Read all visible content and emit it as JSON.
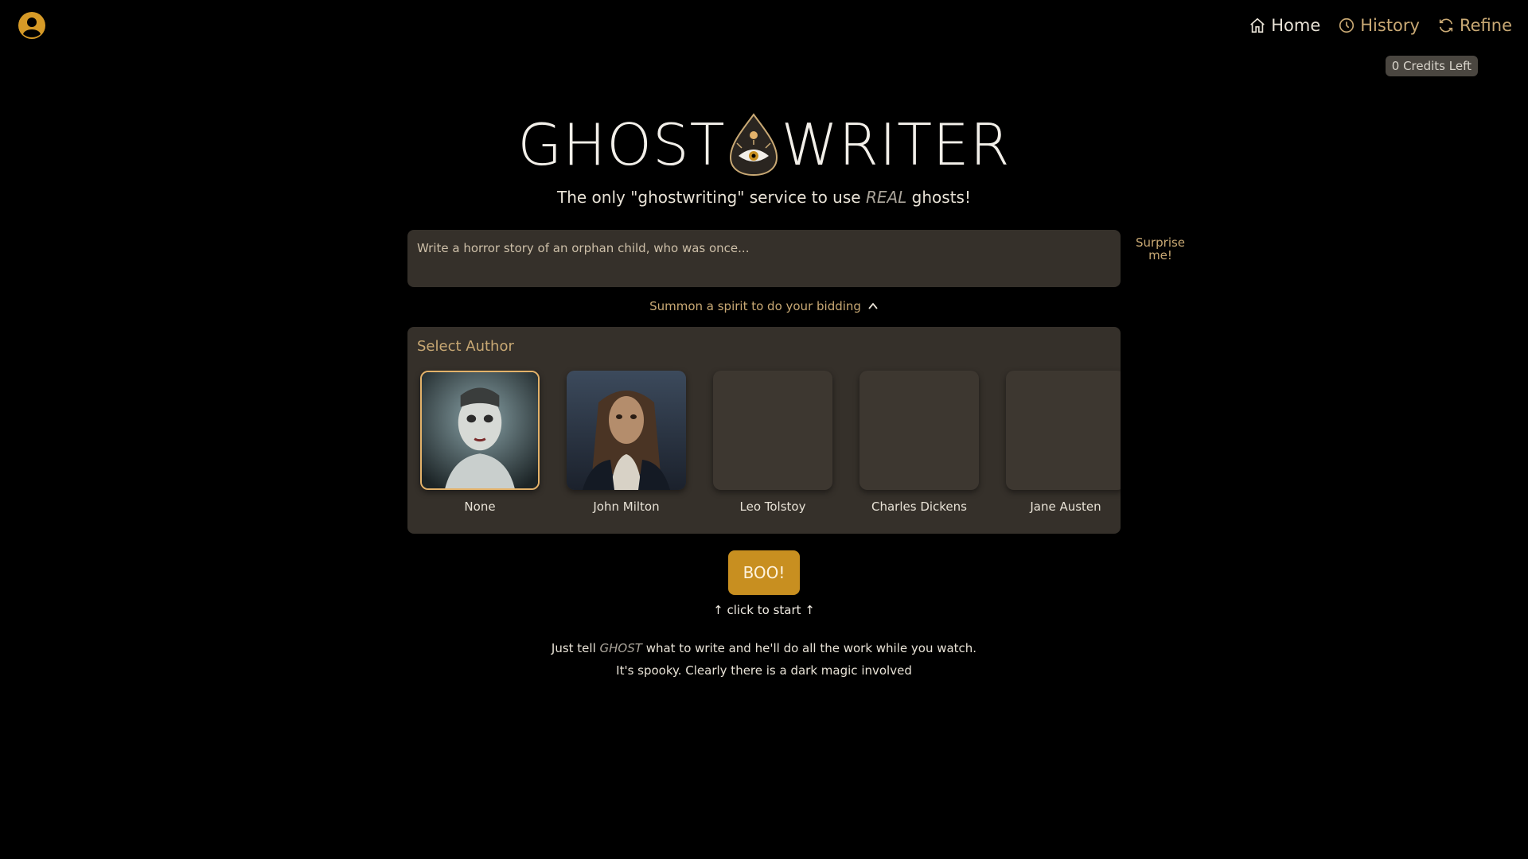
{
  "nav": {
    "items": [
      {
        "label": "Home",
        "icon": "home-icon"
      },
      {
        "label": "History",
        "icon": "clock-icon"
      },
      {
        "label": "Refine",
        "icon": "refresh-icon"
      }
    ],
    "credits": "0 Credits Left"
  },
  "hero": {
    "logo_left": "GHOST",
    "logo_right": "WRITER",
    "tagline_before": "The only \"ghostwriting\" service to use ",
    "tagline_emphasis": "REAL",
    "tagline_after": " ghosts!"
  },
  "prompt": {
    "placeholder": "Write a horror story of an orphan child, who was once...",
    "value": ""
  },
  "surprise_label": "Surprise me!",
  "summon_label": "Summon a spirit to do your bidding",
  "author_panel": {
    "title": "Select Author",
    "authors": [
      {
        "name": "None",
        "selected": true
      },
      {
        "name": "John Milton",
        "selected": false
      },
      {
        "name": "Leo Tolstoy",
        "selected": false
      },
      {
        "name": "Charles Dickens",
        "selected": false
      },
      {
        "name": "Jane Austen",
        "selected": false
      }
    ]
  },
  "boo_label": "BOO!",
  "hint": "↑ click to start ↑",
  "description": {
    "line1_before": "Just tell ",
    "line1_emphasis": "GHOST",
    "line1_after": " what to write and he'll do all the work while you watch.",
    "line2": "It's spooky. Clearly there is a dark magic involved"
  },
  "colors": {
    "background": "#000000",
    "panel": "#35302a",
    "accent": "#c88f20",
    "gold_text": "#c9a974"
  }
}
